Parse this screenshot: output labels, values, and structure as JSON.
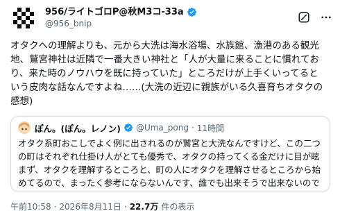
{
  "author": {
    "display_name": "956/ライトゴロP@秋M3コ-33a",
    "handle": "@956_bnip"
  },
  "post": {
    "text": "オタクへの理解よりも、元から大洗は海水浴場、水族館、漁港のある観光\n地、鷲宮神社は近隣で一番大きい神社と「人が大量に来ることに慣れてお\nり、来た時のノウハウを既に持っていた」ところだけが上手くいってると\nいう皮肉な話なんですよね……(大洗の近辺に親族がいる久喜育ちオタクの\n感想)"
  },
  "quote": {
    "display_name": "ぽん。(ぽん。レノン)",
    "handle": "@Uma_pong",
    "separator": "·",
    "time": "11時間",
    "text": "オタク系町おこしでよく例に出されるのが鷲宮と大洗なんですけど、この二つ\nの町はそれぞれ仕掛け人がとても優秀で、オタクの持ってくる金だけに目が眩\nまず、オタクを理解するところと、町の人にオタクを理解させるところから始\nめてるので、まったく参考にならないんです、誰でも出来そうで出来ないので"
  },
  "meta": {
    "time": "午前10:58",
    "dot1": "·",
    "date": "2026年8月11日",
    "dot2": "·",
    "views": "22.7万",
    "views_label": "件の表示"
  },
  "colors": {
    "verified": "#1d9bf0",
    "secondary_text": "#536471",
    "border": "#cfd9de"
  },
  "icons": {
    "grok": "grok-icon",
    "more": "more-icon",
    "verified": "verified-icon"
  }
}
